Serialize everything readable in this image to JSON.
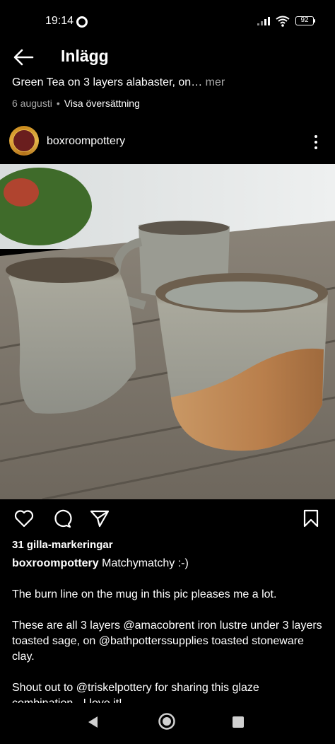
{
  "status_bar": {
    "time": "19:14",
    "battery": "92",
    "icons": [
      "status-dot-icon",
      "signal-icon",
      "wifi-icon",
      "battery-icon"
    ]
  },
  "header": {
    "title": "Inlägg",
    "back_icon": "back-arrow-icon"
  },
  "post": {
    "caption_preview": "Green Tea on 3 layers alabaster, on…",
    "more_label": " mer",
    "date": "6 augusti",
    "separator": "•",
    "translate_label": "Visa översättning",
    "author": "boxroompottery",
    "menu_icon": "more-vertical-icon",
    "likes": "31 gilla-markeringar",
    "caption_user": "boxroompottery",
    "caption_first_line": " Matchymatchy :-)",
    "caption_paragraphs": [
      "The burn line on the mug in this pic pleases me a lot.",
      "These are all 3 layers @amacobrent iron lustre under 3 layers toasted sage, on @bathpotterssupplies toasted stoneware clay.",
      "Shout out to @triskelpottery for sharing this glaze combination - I love it!"
    ]
  },
  "actions": {
    "icons": [
      "heart-icon",
      "comment-icon",
      "share-icon",
      "bookmark-icon"
    ]
  },
  "nav_bar": {
    "icons": [
      "nav-back-icon",
      "nav-home-icon",
      "nav-recents-icon"
    ]
  },
  "colors": {
    "background": "#000000",
    "text": "#ffffff",
    "secondary_text": "#a8a8a8",
    "avatar_ring": "#e2b54a",
    "avatar_fill": "#6a1e1e"
  }
}
